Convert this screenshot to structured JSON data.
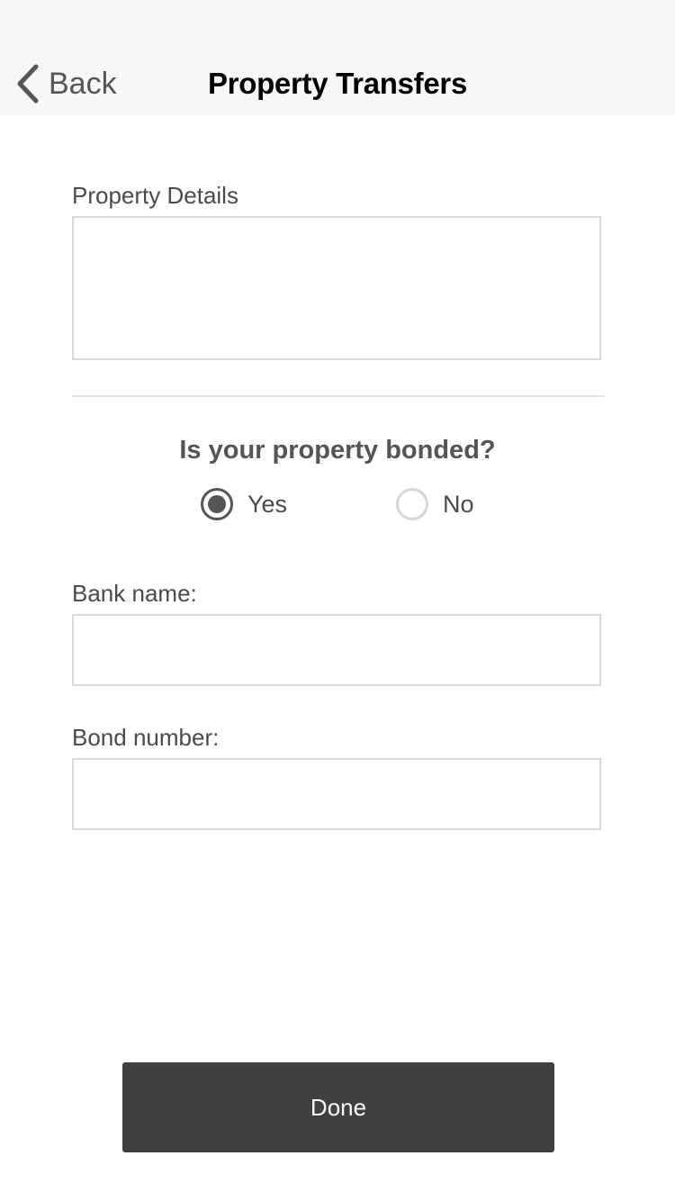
{
  "nav": {
    "back_label": "Back",
    "title": "Property Transfers"
  },
  "form": {
    "property_details": {
      "label": "Property Details",
      "value": ""
    },
    "bonded_question": {
      "label": "Is your property bonded?",
      "options": [
        {
          "label": "Yes",
          "selected": true
        },
        {
          "label": "No",
          "selected": false
        }
      ]
    },
    "bank_name": {
      "label": "Bank name:",
      "value": ""
    },
    "bond_number": {
      "label": "Bond number:",
      "value": ""
    }
  },
  "actions": {
    "done_label": "Done"
  },
  "colors": {
    "nav_background": "#f7f7f7",
    "button_background": "#404040",
    "radio_selected": "#555555",
    "radio_unselected": "#d6d6d6"
  }
}
